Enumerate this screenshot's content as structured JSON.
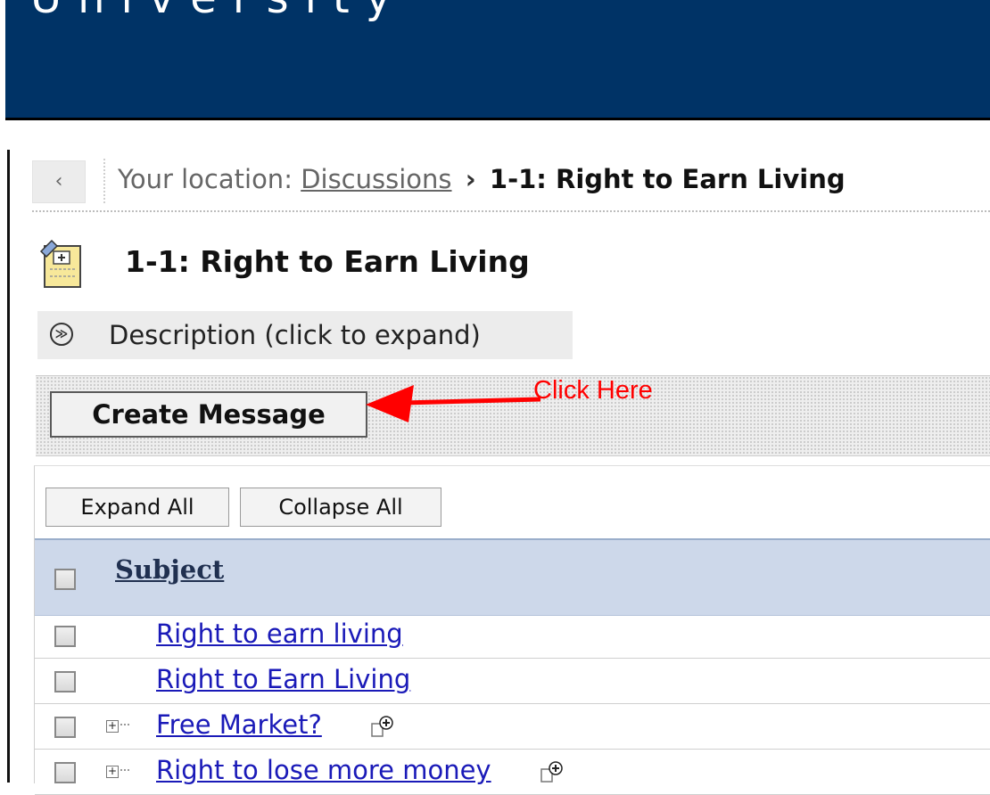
{
  "header": {
    "institution_fragment": "University"
  },
  "breadcrumb": {
    "back_label": "‹",
    "prefix": "Your location:",
    "parent_link": "Discussions",
    "separator": "›",
    "current": "1-1: Right to Earn Living"
  },
  "page": {
    "title": "1-1: Right to Earn Living",
    "title_icon": "discussion-topic-icon"
  },
  "description": {
    "toggle_label": "Description (click to expand)",
    "icon": "double-chevron-down-icon"
  },
  "actions": {
    "create_message_label": "Create Message"
  },
  "annotation": {
    "label": "Click Here",
    "color": "#ff0000"
  },
  "tree_controls": {
    "expand_label": "Expand All",
    "collapse_label": "Collapse All"
  },
  "list": {
    "column_header": "Subject",
    "rows": [
      {
        "subject": "Right to earn living",
        "has_children": false
      },
      {
        "subject": "Right to Earn Living",
        "has_children": false
      },
      {
        "subject": "Free Market?",
        "has_children": true
      },
      {
        "subject": "Right to lose more money",
        "has_children": true
      }
    ]
  },
  "colors": {
    "header_bg": "#003366",
    "list_header_bg": "#cdd8ea",
    "link": "#1a1ab8",
    "annotation": "#ff0000"
  }
}
